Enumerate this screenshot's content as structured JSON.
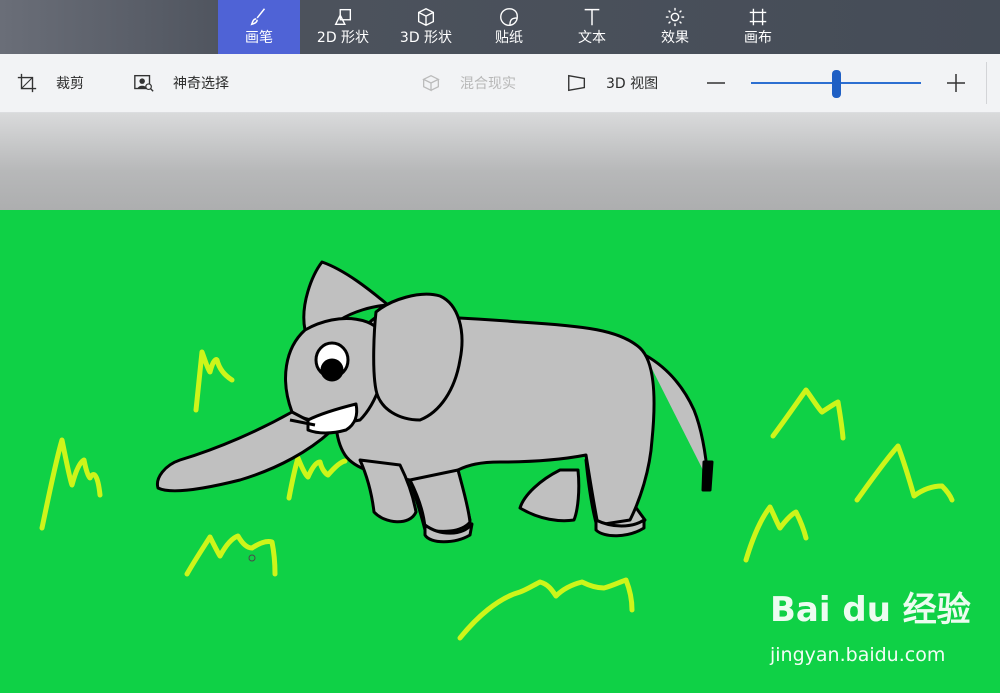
{
  "tabs": [
    {
      "label": "画笔",
      "icon": "brush-icon",
      "active": true
    },
    {
      "label": "2D 形状",
      "icon": "shapes-2d-icon",
      "active": false
    },
    {
      "label": "3D 形状",
      "icon": "cube-icon",
      "active": false
    },
    {
      "label": "贴纸",
      "icon": "sticker-icon",
      "active": false
    },
    {
      "label": "文本",
      "icon": "text-icon",
      "active": false
    },
    {
      "label": "效果",
      "icon": "sun-effects-icon",
      "active": false
    },
    {
      "label": "画布",
      "icon": "canvas-icon",
      "active": false
    }
  ],
  "toolbar": {
    "crop_label": "裁剪",
    "magic_select_label": "神奇选择",
    "mixed_reality_label": "混合现实",
    "view3d_label": "3D 视图",
    "zoom_level_fraction": 0.5
  },
  "watermark": {
    "logo_text": "Bai du 经验",
    "url": "jingyan.baidu.com"
  },
  "colors": {
    "active_tab": "#4f63d6",
    "canvas_green": "#0fd146",
    "grass_yellow": "#cdf51a",
    "elephant_gray": "#c0c0c0",
    "slider_blue": "#1f5fc4"
  }
}
